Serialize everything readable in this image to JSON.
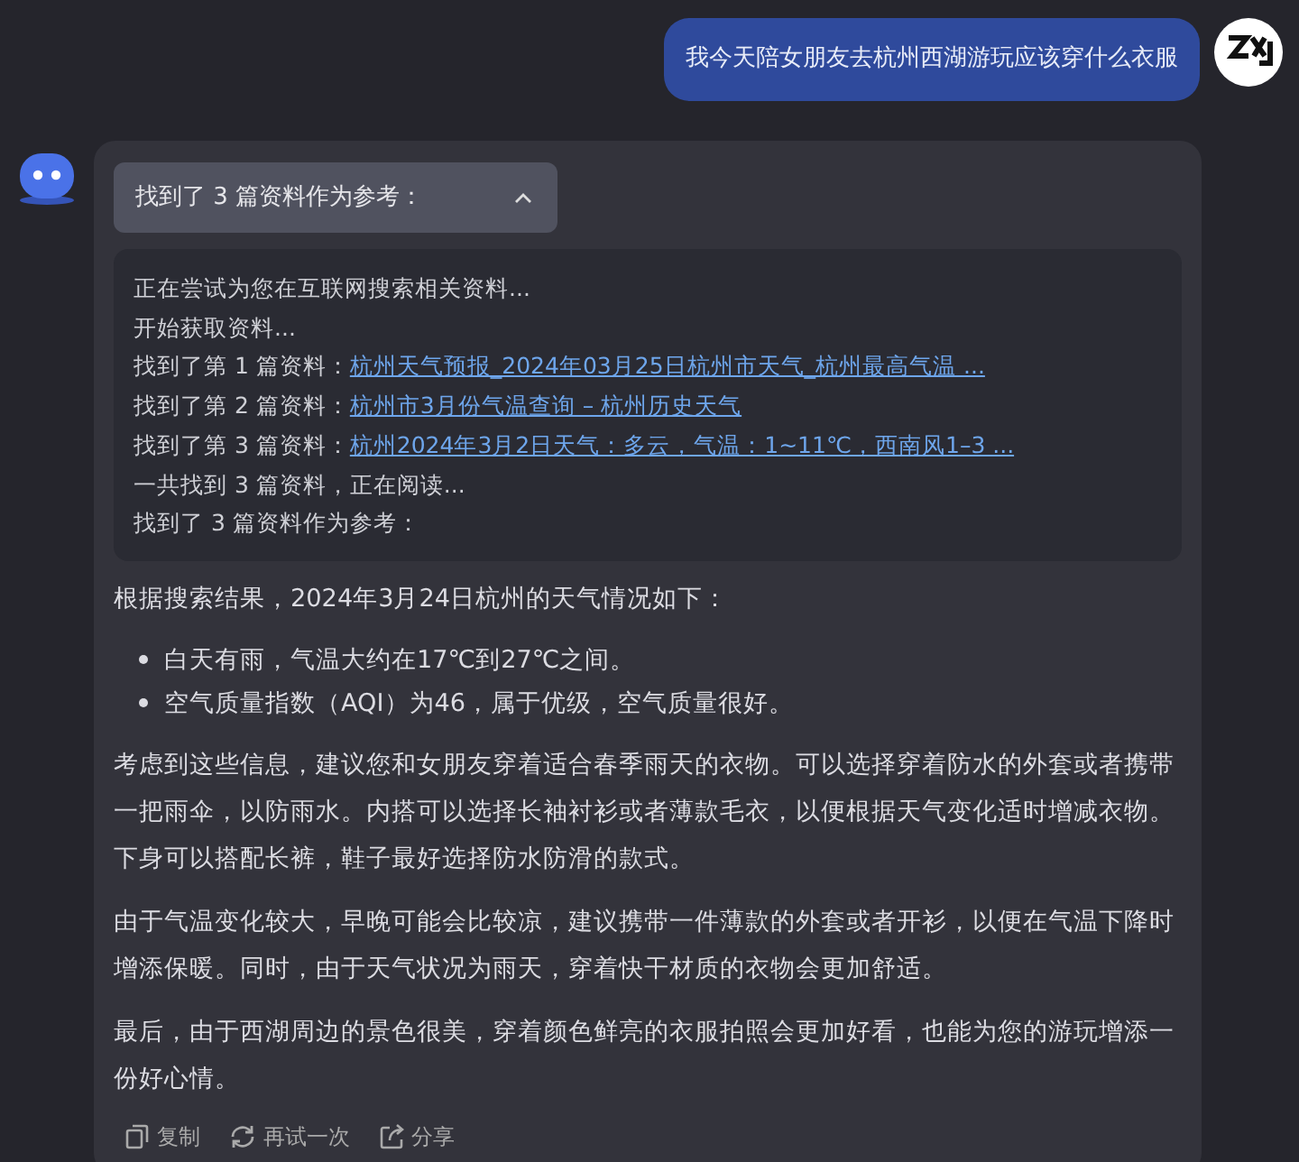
{
  "user_message": {
    "text": "我今天陪女朋友去杭州西湖游玩应该穿什么衣服"
  },
  "sources_toggle": {
    "label": "找到了 3 篇资料作为参考：",
    "expanded": true
  },
  "search_log": [
    {
      "kind": "text",
      "text": "正在尝试为您在互联网搜索相关资料..."
    },
    {
      "kind": "text",
      "text": "开始获取资料..."
    },
    {
      "kind": "link",
      "prefix": "找到了第 1 篇资料：",
      "link": "杭州天气预报_2024年03月25日杭州市天气_杭州最高气温 ..."
    },
    {
      "kind": "link",
      "prefix": "找到了第 2 篇资料：",
      "link": "杭州市3月份气温查询 – 杭州历史天气"
    },
    {
      "kind": "link",
      "prefix": "找到了第 3 篇资料：",
      "link": "杭州2024年3月2日天气：多云，气温：1~11℃，西南风1–3 ..."
    },
    {
      "kind": "text",
      "text": "一共找到 3 篇资料，正在阅读..."
    },
    {
      "kind": "text",
      "text": "找到了 3 篇资料作为参考："
    }
  ],
  "answer": {
    "intro": "根据搜索结果，2024年3月24日杭州的天气情况如下：",
    "bullets": [
      "白天有雨，气温大约在17℃到27℃之间。",
      "空气质量指数（AQI）为46，属于优级，空气质量很好。"
    ],
    "paragraphs": [
      "考虑到这些信息，建议您和女朋友穿着适合春季雨天的衣物。可以选择穿着防水的外套或者携带一把雨伞，以防雨水。内搭可以选择长袖衬衫或者薄款毛衣，以便根据天气变化适时增减衣物。下身可以搭配长裤，鞋子最好选择防水防滑的款式。",
      "由于气温变化较大，早晚可能会比较凉，建议携带一件薄款的外套或者开衫，以便在气温下降时增添保暖。同时，由于天气状况为雨天，穿着快干材质的衣物会更加舒适。",
      "最后，由于西湖周边的景色很美，穿着颜色鲜亮的衣服拍照会更加好看，也能为您的游玩增添一份好心情。"
    ]
  },
  "actions": [
    {
      "kind": "copy",
      "label": "复制"
    },
    {
      "kind": "retry",
      "label": "再试一次"
    },
    {
      "kind": "share",
      "label": "分享"
    }
  ]
}
